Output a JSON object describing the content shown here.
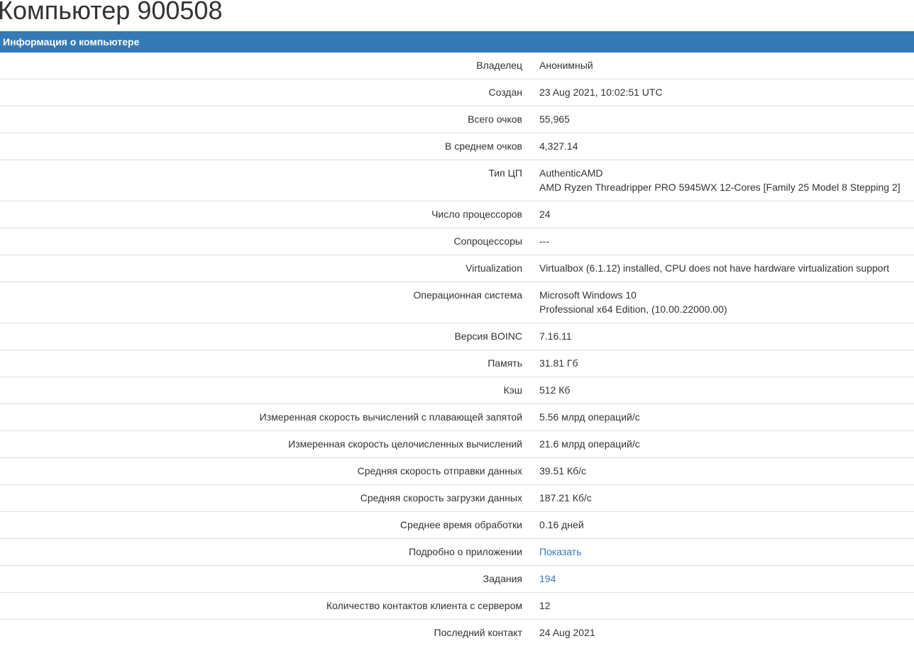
{
  "page": {
    "title": "Компьютер 900508"
  },
  "panel": {
    "header": "Информация о компьютере"
  },
  "rows": [
    {
      "label": "Владелец",
      "lines": [
        "Анонимный"
      ]
    },
    {
      "label": "Создан",
      "lines": [
        "23 Aug 2021, 10:02:51 UTC"
      ]
    },
    {
      "label": "Всего очков",
      "lines": [
        "55,965"
      ]
    },
    {
      "label": "В среднем очков",
      "lines": [
        "4,327.14"
      ]
    },
    {
      "label": "Тип ЦП",
      "lines": [
        "AuthenticAMD",
        "AMD Ryzen Threadripper PRO 5945WX 12-Cores [Family 25 Model 8 Stepping 2]"
      ]
    },
    {
      "label": "Число процессоров",
      "lines": [
        "24"
      ]
    },
    {
      "label": "Сопроцессоры",
      "lines": [
        "---"
      ]
    },
    {
      "label": "Virtualization",
      "lines": [
        "Virtualbox (6.1.12) installed, CPU does not have hardware virtualization support"
      ]
    },
    {
      "label": "Операционная система",
      "lines": [
        "Microsoft Windows 10",
        "Professional x64 Edition, (10.00.22000.00)"
      ]
    },
    {
      "label": "Версия BOINC",
      "lines": [
        "7.16.11"
      ]
    },
    {
      "label": "Память",
      "lines": [
        "31.81 Гб"
      ]
    },
    {
      "label": "Кэш",
      "lines": [
        "512 Кб"
      ]
    },
    {
      "label": "Измеренная скорость вычислений с плавающей запятой",
      "lines": [
        "5.56 млрд операций/с"
      ]
    },
    {
      "label": "Измеренная скорость целочисленных вычислений",
      "lines": [
        "21.6 млрд операций/с"
      ]
    },
    {
      "label": "Средняя скорость отправки данных",
      "lines": [
        "39.51 Кб/с"
      ]
    },
    {
      "label": "Средняя скорость загрузки данных",
      "lines": [
        "187.21 Кб/с"
      ]
    },
    {
      "label": "Среднее время обработки",
      "lines": [
        "0.16 дней"
      ]
    },
    {
      "label": "Подробно о приложении",
      "link": "Показать"
    },
    {
      "label": "Задания",
      "link": "194"
    },
    {
      "label": "Количество контактов клиента с сервером",
      "lines": [
        "12"
      ]
    },
    {
      "label": "Последний контакт",
      "lines": [
        "24 Aug 2021"
      ]
    }
  ],
  "colors": {
    "header_bg": "#337ab7",
    "header_text": "#ffffff",
    "link": "#337ab7",
    "row_border": "#dddddd",
    "text": "#333333"
  }
}
